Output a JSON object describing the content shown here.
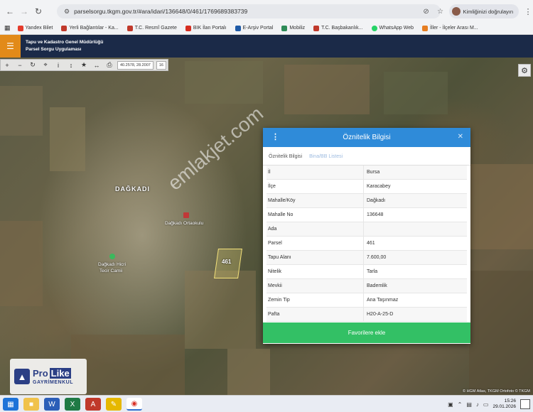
{
  "browser": {
    "url": "parselsorgu.tkgm.gov.tr/#ara/idari/136648/0/461/1769689383739",
    "profile_label": "Kimliğinizi doğrulayın",
    "bookmarks": [
      {
        "label": "Yandex Bilet",
        "color": "#e43b2c"
      },
      {
        "label": "Yerli Bağlantılar - Ka...",
        "color": "#c0392b"
      },
      {
        "label": "T.C. Resmî Gazete",
        "color": "#c0392b"
      },
      {
        "label": "BIK İlan Portalı",
        "color": "#d62d20"
      },
      {
        "label": "E-Arşiv Portal",
        "color": "#1f5aa6"
      },
      {
        "label": "Mobiliz",
        "color": "#2e8b57"
      },
      {
        "label": "T.C. Başbakanlık...",
        "color": "#c0392b"
      },
      {
        "label": "WhatsApp Web",
        "color": "#25d366"
      },
      {
        "label": "İller - İlçeler Arası M...",
        "color": "#e67e22"
      }
    ]
  },
  "app": {
    "org": "Tapu ve Kadastro Genel Müdürlüğü",
    "title": "Parsel Sorgu Uygulaması"
  },
  "toolbar": {
    "coords": "40.2578, 28.2007",
    "zoom": "16"
  },
  "map": {
    "village": "DAĞKADI",
    "school": "Dağkadı Ortaokulu",
    "mosque_line1": "Dağkadı Hicri",
    "mosque_line2": "Tecir Camii",
    "parcel_no": "461",
    "attribution": "© HGM Atlas, TKGM Ortofoto © TKGM"
  },
  "panel": {
    "title": "Öznitelik Bilgisi",
    "tabs": [
      "Öznitelik Bilgisi",
      "Bina/BB Listesi"
    ],
    "rows": [
      {
        "label": "İl",
        "value": "Bursa"
      },
      {
        "label": "İlçe",
        "value": "Karacabey"
      },
      {
        "label": "Mahalle/Köy",
        "value": "Dağkadı"
      },
      {
        "label": "Mahalle No",
        "value": "136648"
      },
      {
        "label": "Ada",
        "value": ""
      },
      {
        "label": "Parsel",
        "value": "461"
      },
      {
        "label": "Tapu Alanı",
        "value": "7.600,00"
      },
      {
        "label": "Nitelik",
        "value": "Tarla"
      },
      {
        "label": "Mevkii",
        "value": "Bademlik"
      },
      {
        "label": "Zemin Tip",
        "value": "Ana Taşınmaz"
      },
      {
        "label": "Pafta",
        "value": "H20-A-25-D"
      }
    ],
    "favorite_button": "Favorilere ekle"
  },
  "watermark": "emlakjet.com",
  "logo": {
    "pro": "Pro",
    "like": "Like",
    "sub": "GAYRİMENKUL"
  },
  "taskbar": {
    "time": "15:26",
    "date": "29.01.2026"
  }
}
